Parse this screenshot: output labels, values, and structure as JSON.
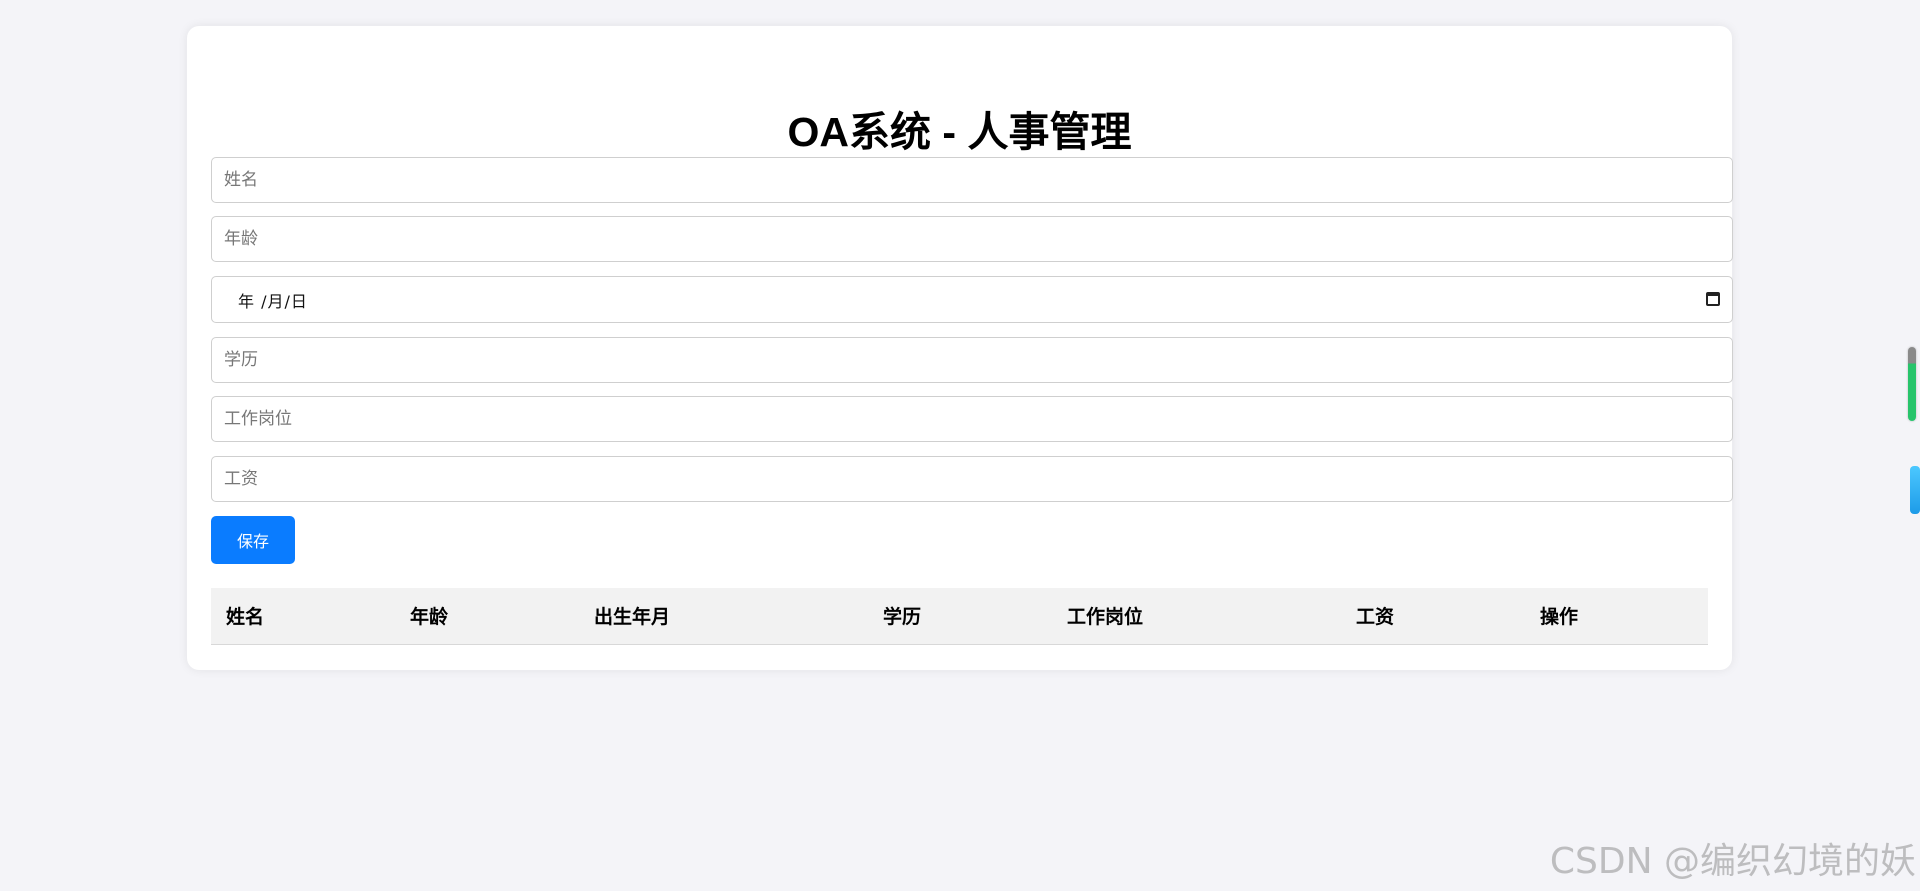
{
  "header": {
    "title": "OA系统 - 人事管理"
  },
  "form": {
    "name_placeholder": "姓名",
    "age_placeholder": "年龄",
    "birth_date_display": "年 /月/日",
    "education_placeholder": "学历",
    "position_placeholder": "工作岗位",
    "salary_placeholder": "工资",
    "save_label": "保存"
  },
  "table": {
    "columns": [
      "姓名",
      "年龄",
      "出生年月",
      "学历",
      "工作岗位",
      "工资",
      "操作"
    ],
    "rows": []
  },
  "colors": {
    "primary": "#0a7cff",
    "background": "#f4f4f8",
    "card": "#ffffff",
    "table_header": "#f2f2f2"
  },
  "icons": {
    "date_picker": "calendar-icon"
  },
  "watermark": "CSDN @编织幻境的妖"
}
